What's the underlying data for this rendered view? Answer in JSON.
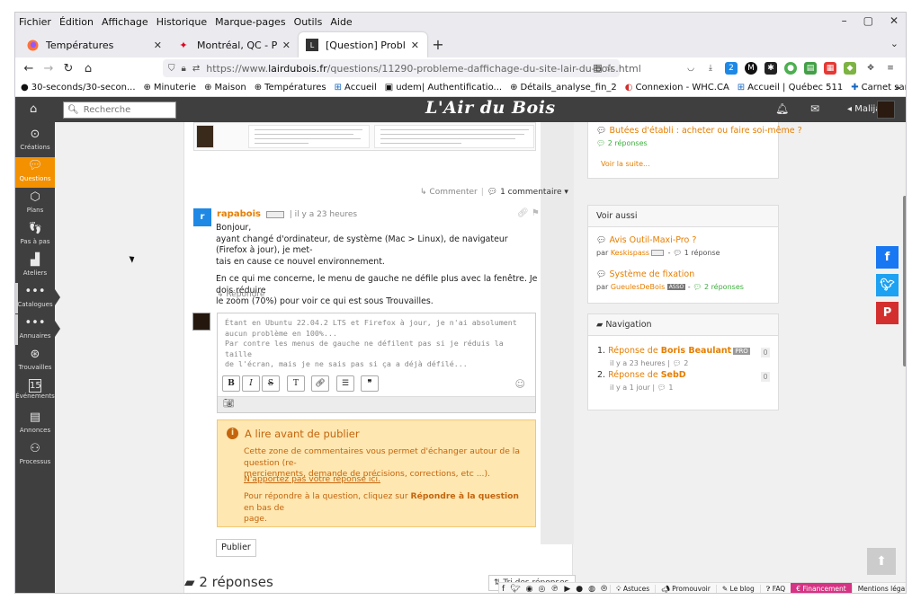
{
  "menubar": {
    "items": [
      "Fichier",
      "Édition",
      "Affichage",
      "Historique",
      "Marque-pages",
      "Outils",
      "Aide"
    ]
  },
  "tabs": [
    {
      "title": "Températures",
      "icon": "firefox-icon"
    },
    {
      "title": "Montréal, QC - Prévision",
      "icon": "maple-leaf-icon"
    },
    {
      "title": "[Question] Problème d'af",
      "icon": "lairdubois-icon"
    }
  ],
  "navbar": {
    "url_prefix": "https://www.",
    "url_host": "lairdubois.fr",
    "url_path": "/questions/11290-probleme-daffichage-du-site-lair-du-bois.html",
    "ext_badge": "2"
  },
  "bookmarks": [
    "30-seconds/30-secon...",
    "Minuterie",
    "Maison",
    "Températures",
    "Accueil",
    "udem| Authentificatio...",
    "Détails_analyse_fin_2",
    "Connexion - WHC.CA",
    "Accueil | Québec 511",
    "Carnet santé Québec ..."
  ],
  "site": {
    "logo": "L'Air du Bois",
    "search_placeholder": "Recherche",
    "user": "Malijal"
  },
  "leftnav": [
    {
      "label": "Créations",
      "icon": "creations-icon"
    },
    {
      "label": "Questions",
      "icon": "questions-icon"
    },
    {
      "label": "Plans",
      "icon": "plans-icon"
    },
    {
      "label": "Pas à pas",
      "icon": "steps-icon"
    },
    {
      "label": "Ateliers",
      "icon": "workshop-icon"
    },
    {
      "label": "Catalogues",
      "icon": "catalogs-icon"
    },
    {
      "label": "Annuaires",
      "icon": "directory-icon"
    },
    {
      "label": "Trouvailles",
      "icon": "finds-icon"
    },
    {
      "label": "Événements",
      "icon": "calendar-icon"
    },
    {
      "label": "Annonces",
      "icon": "ads-icon"
    },
    {
      "label": "Processus",
      "icon": "process-icon"
    }
  ],
  "question": {
    "comment_action": "Commenter",
    "comment_count": "1 commentaire"
  },
  "answer": {
    "author": "rapabois",
    "time": "il y a 23 heures",
    "p1_l1": "Bonjour,",
    "p1_l2": "ayant changé d'ordinateur, de système (Mac > Linux), de navigateur (Firefox à jour), je met-",
    "p1_l3": "tais en cause ce nouvel environnement.",
    "p2_l1": "En ce qui me concerne, le menu de gauche ne défile plus avec la fenêtre. Je dois réduire",
    "p2_l2": "le zoom (70%) pour voir ce qui est sous Trouvailles.",
    "reply": "Répondre"
  },
  "editor": {
    "text": "Étant en Ubuntu 22.04.2 LTS et Firefox à jour, je n'ai absolument\naucun problème en 100%...\nPar contre les menus de gauche ne défilent pas si je réduis la taille\nde l'écran, mais je ne sais pas si ça a déjà défilé..."
  },
  "infobox": {
    "title": "A lire avant de publier",
    "l1": "Cette zone de commentaires vous permet d'échanger autour de la question (re-",
    "l2": "mercienments, demande de précisions, corrections, etc ...).",
    "warn": "N'apportez pas votre réponse ici.",
    "l3_a": "Pour répondre à la question, cliquez sur ",
    "l3_b": "Répondre à la question",
    "l3_c": " en bas de",
    "l4": "page."
  },
  "publish": "Publier",
  "answers": {
    "title": "2 réponses",
    "sort": "Tri des réponses"
  },
  "sidebar": {
    "top_link": "Butées d'établi : acheter ou faire soi-même ?",
    "top_meta": "2 réponses",
    "see_more": "Voir la suite...",
    "voir_aussi": "Voir aussi",
    "va_items": [
      {
        "title": "Avis Outil-Maxi-Pro ?",
        "user": "Keskispass",
        "sep": " - ",
        "replies": "1 réponse"
      },
      {
        "title": "Système de fixation",
        "user": "GueulesDeBois",
        "badge": "ASSO",
        "sep": " - ",
        "replies": "2 réponses"
      }
    ],
    "nav_title": "Navigation",
    "nav_items": [
      {
        "num": "1.",
        "prefix": "Réponse de ",
        "author": "Boris Beaulant",
        "badge": "PRO",
        "meta": "il y a 23 heures",
        "comments": "2",
        "count": "0"
      },
      {
        "num": "2.",
        "prefix": "Réponse de ",
        "author": "SebD",
        "meta": "il y a 1 jour",
        "comments": "1",
        "count": "0"
      }
    ]
  },
  "footer": {
    "astuces": "Astuces",
    "promouvoir": "Promouvoir",
    "blog": "Le blog",
    "faq": "FAQ",
    "financement": "Financement",
    "mentions": "Mentions légales"
  },
  "colors": {
    "accent": "#f39100",
    "link": "#e67e00",
    "header": "#3f3f3f",
    "info_bg": "#fee7b1",
    "info_text": "#c4650e",
    "facebook": "#1877f2",
    "twitter": "#1da1f2",
    "pinterest": "#d32f2f"
  }
}
